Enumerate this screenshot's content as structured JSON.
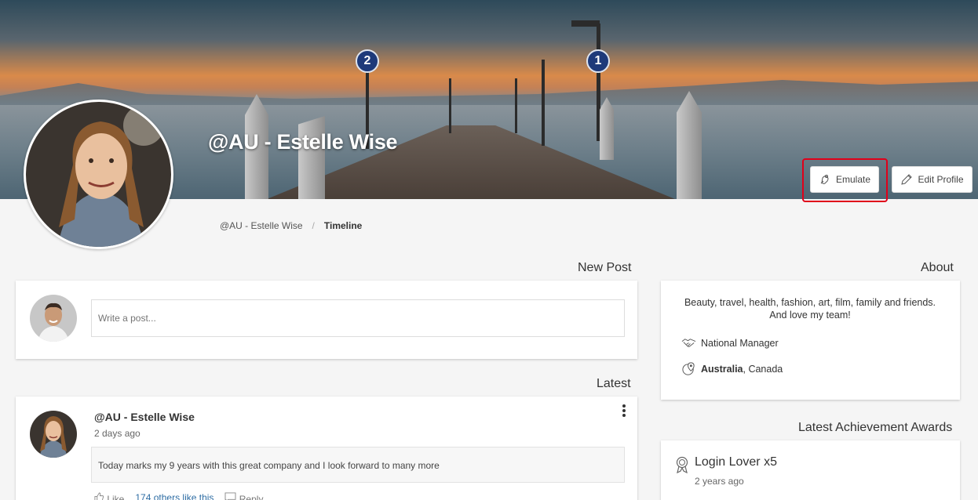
{
  "profile": {
    "name": "@AU - Estelle Wise"
  },
  "header_buttons": {
    "emulate_label": "Emulate",
    "edit_profile_label": "Edit Profile"
  },
  "cover": {
    "sign_left": "2",
    "sign_right": "1"
  },
  "breadcrumb": {
    "items": [
      "@AU - Estelle Wise",
      "Timeline"
    ]
  },
  "new_post": {
    "title": "New Post",
    "placeholder": "Write a post..."
  },
  "latest": {
    "title": "Latest",
    "post": {
      "author": "@AU - Estelle Wise",
      "time": "2 days ago",
      "text": "Today marks my 9 years with this great company and I look forward to many more",
      "like_label": "Like",
      "likes_text": "174 others like this",
      "reply_label": "Reply"
    }
  },
  "about": {
    "title": "About",
    "bio_line1": "Beauty, travel, health, fashion, art, film, family and friends.",
    "bio_line2": "And love my team!",
    "role": "National Manager",
    "location_primary": "Australia",
    "location_rest": ", Canada"
  },
  "awards": {
    "title": "Latest Achievement Awards",
    "items": [
      {
        "name": "Login Lover x5",
        "time": "2 years ago"
      }
    ]
  },
  "icons": {
    "emulate": "emulate-hand-icon",
    "edit": "pencil-icon",
    "role": "handshake-icon",
    "location": "location-pin-icon",
    "award": "ribbon-award-icon",
    "more": "kebab-menu-icon",
    "like": "thumbs-up-icon",
    "reply": "comment-icon"
  },
  "colors": {
    "highlight": "#e0001a",
    "link": "#2e6da4",
    "background": "#f5f5f5"
  }
}
